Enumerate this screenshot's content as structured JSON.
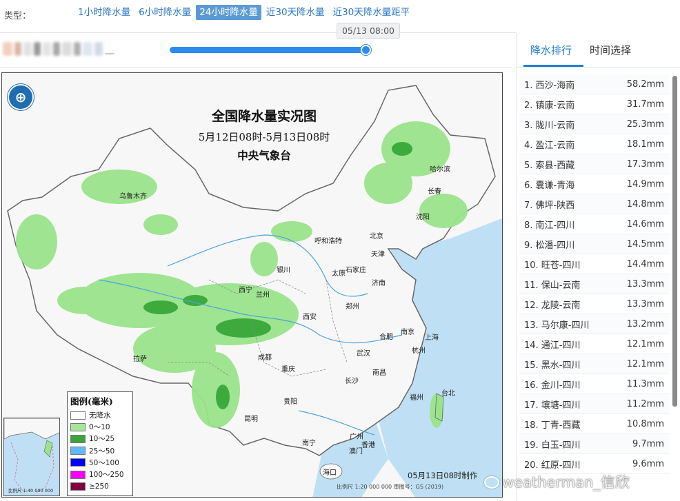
{
  "typebar": {
    "label": "类型：",
    "tabs": [
      {
        "label": "1小时降水量",
        "active": false
      },
      {
        "label": "6小时降水量",
        "active": false
      },
      {
        "label": "24小时降水量",
        "active": true
      },
      {
        "label": "近30天降水量",
        "active": false
      },
      {
        "label": "近30天降水量距平",
        "active": false
      }
    ]
  },
  "slider": {
    "tooltip": "05/13 08:00",
    "progress_fraction": 1.0
  },
  "map": {
    "title": "全国降水量实况图",
    "subtitle": "5月12日08时-5月13日08时",
    "issuer": "中央气象台",
    "made_text": "05月13日08时制作",
    "scale_text": "比例尺  1:20 000 000      审图号：GS (2019)",
    "inset_scale": "比例尺 1:40 000 000",
    "colors": {
      "land": "#f7f7f7",
      "sea": "#bfe0f4",
      "light_rain": "#9be38b",
      "moderate_rain": "#3daa3d",
      "river": "#4aa3e0",
      "border": "#666666"
    },
    "cities": [
      "乌鲁木齐",
      "哈尔滨",
      "长春",
      "沈阳",
      "呼和浩特",
      "北京",
      "天津",
      "石家庄",
      "太原",
      "银川",
      "西宁",
      "兰州",
      "济南",
      "郑州",
      "西安",
      "合肥",
      "南京",
      "上海",
      "杭州",
      "武汉",
      "成都",
      "重庆",
      "拉萨",
      "长沙",
      "南昌",
      "福州",
      "台北",
      "贵阳",
      "昆明",
      "南宁",
      "广州",
      "澳门",
      "香港",
      "海口"
    ],
    "legend": {
      "title": "图例(毫米)",
      "items": [
        {
          "label": "无降水",
          "color": "#ffffff"
        },
        {
          "label": "0～10",
          "color": "#a6e59a"
        },
        {
          "label": "10～25",
          "color": "#3aa53a"
        },
        {
          "label": "25～50",
          "color": "#61b8ff"
        },
        {
          "label": "50～100",
          "color": "#0000ff"
        },
        {
          "label": "100～250",
          "color": "#fa00fa"
        },
        {
          "label": "≥250",
          "color": "#800040"
        }
      ]
    }
  },
  "panel": {
    "tabs": [
      "降水排行",
      "时间选择"
    ],
    "ranking": [
      {
        "name": "1. 西沙-海南",
        "value": "58.2mm"
      },
      {
        "name": "2. 镇康-云南",
        "value": "31.7mm"
      },
      {
        "name": "3. 陇川-云南",
        "value": "25.3mm"
      },
      {
        "name": "4. 盈江-云南",
        "value": "18.1mm"
      },
      {
        "name": "5. 索县-西藏",
        "value": "17.3mm"
      },
      {
        "name": "6. 囊谦-青海",
        "value": "14.9mm"
      },
      {
        "name": "7. 佛坪-陕西",
        "value": "14.8mm"
      },
      {
        "name": "8. 南江-四川",
        "value": "14.6mm"
      },
      {
        "name": "9. 松潘-四川",
        "value": "14.5mm"
      },
      {
        "name": "10. 旺苍-四川",
        "value": "14.4mm"
      },
      {
        "name": "11. 保山-云南",
        "value": "13.3mm"
      },
      {
        "name": "12. 龙陵-云南",
        "value": "13.3mm"
      },
      {
        "name": "13. 马尔康-四川",
        "value": "13.2mm"
      },
      {
        "name": "14. 通江-四川",
        "value": "12.1mm"
      },
      {
        "name": "15. 黑水-四川",
        "value": "12.1mm"
      },
      {
        "name": "16. 金川-四川",
        "value": "11.3mm"
      },
      {
        "name": "17. 壤塘-四川",
        "value": "11.2mm"
      },
      {
        "name": "18. 丁青-西藏",
        "value": "10.8mm"
      },
      {
        "name": "19. 白玉-四川",
        "value": "9.7mm"
      },
      {
        "name": "20. 红原-四川",
        "value": "9.6mm"
      }
    ]
  },
  "watermark": "weatherman_信欣"
}
